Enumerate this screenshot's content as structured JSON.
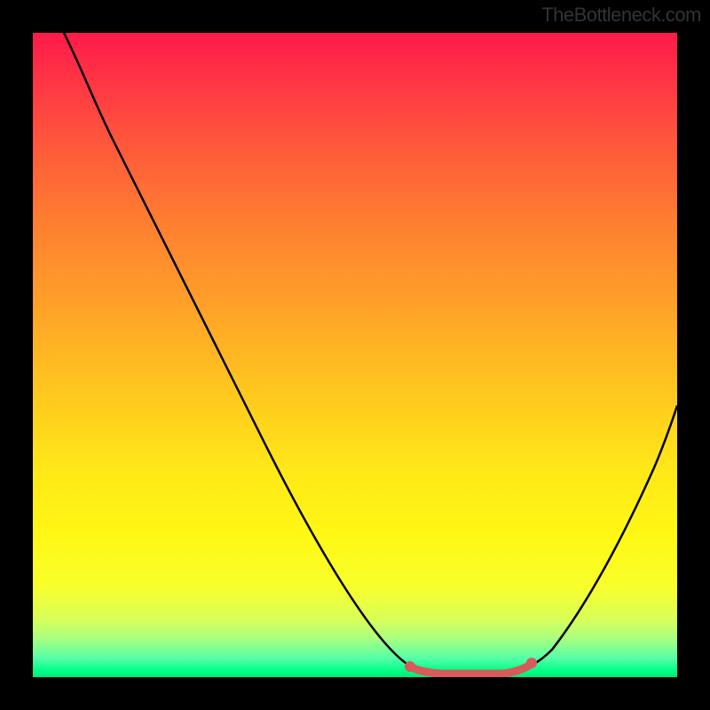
{
  "watermark": "TheBottleneck.com",
  "chart_data": {
    "type": "line",
    "title": "",
    "xlabel": "",
    "ylabel": "",
    "xlim": [
      0,
      100
    ],
    "ylim": [
      0,
      100
    ],
    "x": [
      5,
      10,
      15,
      20,
      25,
      30,
      35,
      40,
      45,
      50,
      53,
      56,
      59,
      62,
      65,
      68,
      72,
      76,
      80,
      85,
      90,
      95,
      100
    ],
    "y": [
      100,
      92,
      83,
      74,
      65,
      56,
      47,
      38,
      29,
      20,
      13,
      8,
      4,
      1,
      0,
      0,
      0,
      1,
      5,
      13,
      24,
      37,
      52
    ],
    "marker_region": {
      "x_start": 62,
      "x_end": 78,
      "color": "#e06666"
    },
    "gradient_stops": [
      {
        "pos": 0,
        "color": "#ff1a4a"
      },
      {
        "pos": 50,
        "color": "#ffc81e"
      },
      {
        "pos": 85,
        "color": "#f8ff2c"
      },
      {
        "pos": 100,
        "color": "#00e878"
      }
    ]
  }
}
